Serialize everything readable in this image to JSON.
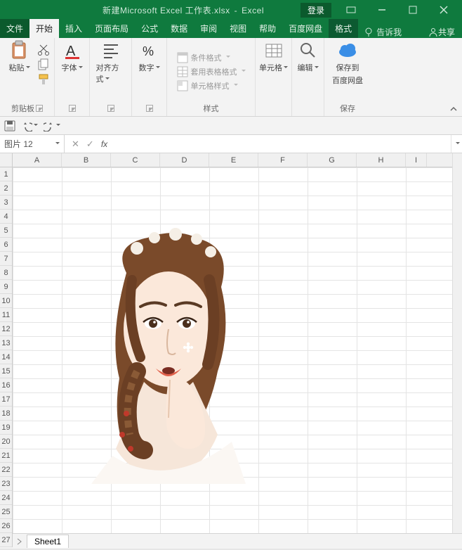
{
  "titlebar": {
    "filename": "新建Microsoft Excel 工作表.xlsx",
    "app": "Excel",
    "login": "登录"
  },
  "tabs": {
    "file": "文件",
    "home": "开始",
    "insert": "插入",
    "pagelayout": "页面布局",
    "formulas": "公式",
    "data": "数据",
    "review": "审阅",
    "view": "视图",
    "help": "帮助",
    "baidu": "百度网盘",
    "format": "格式",
    "tellme": "告诉我",
    "share": "共享"
  },
  "ribbon": {
    "clipboard": {
      "paste": "粘贴",
      "group": "剪贴板"
    },
    "font": {
      "label": "字体"
    },
    "align": {
      "label": "对齐方式"
    },
    "number": {
      "label": "数字"
    },
    "styles": {
      "condfmt": "条件格式",
      "tablefmt": "套用表格格式",
      "cellfmt": "单元格样式",
      "group": "样式"
    },
    "cells": {
      "label": "单元格"
    },
    "editing": {
      "label": "编辑"
    },
    "save": {
      "label1": "保存到",
      "label2": "百度网盘",
      "group": "保存"
    }
  },
  "namebox": {
    "value": "图片 12"
  },
  "formula": {
    "value": ""
  },
  "grid": {
    "cols": [
      "A",
      "B",
      "C",
      "D",
      "E",
      "F",
      "G",
      "H",
      "I"
    ],
    "rows": [
      "1",
      "2",
      "3",
      "4",
      "5",
      "6",
      "7",
      "8",
      "9",
      "10",
      "11",
      "12",
      "13",
      "14",
      "15",
      "16",
      "17",
      "18",
      "19",
      "20",
      "21",
      "22",
      "23",
      "24",
      "25",
      "26",
      "27"
    ]
  },
  "sheettab": {
    "name": "Sheet1"
  }
}
